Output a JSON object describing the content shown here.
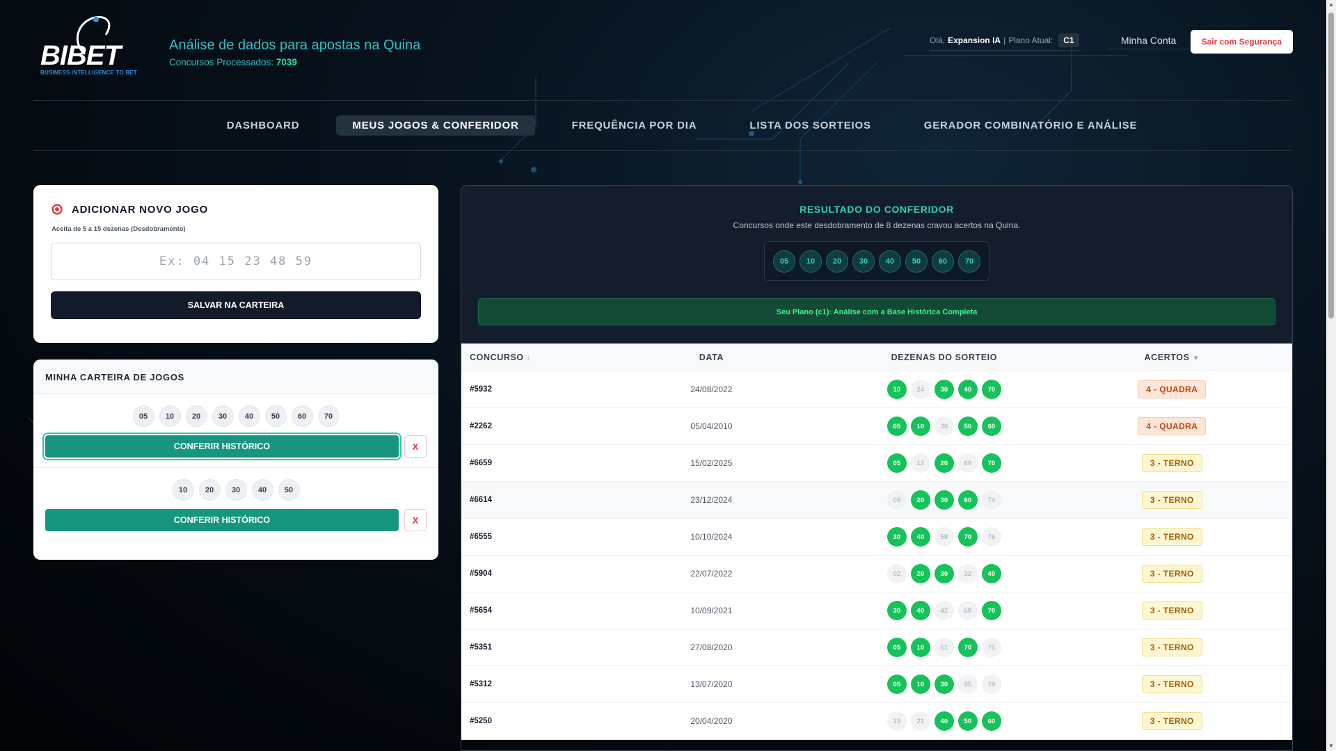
{
  "brand": {
    "logo_text": "BIBET",
    "logo_sub": "BUSINESS INTELLIGENCE TO BET",
    "tagline": "Análise de dados para apostas na Quina",
    "processed_label": "Concursos Processados:",
    "processed_value": "7039"
  },
  "user": {
    "greeting": "Olá,",
    "name": "Expansion IA",
    "separator": "|",
    "plan_label": "Plano Atual:",
    "plan": "C1",
    "account_link": "Minha Conta",
    "logout": "Sair com Segurança"
  },
  "nav": {
    "items": [
      {
        "label": "DASHBOARD"
      },
      {
        "label": "MEUS JOGOS & CONFERIDOR"
      },
      {
        "label": "FREQUÊNCIA POR DIA"
      },
      {
        "label": "LISTA DOS SORTEIOS"
      },
      {
        "label": "GERADOR COMBINATÓRIO E ANÁLISE"
      }
    ],
    "active_index": 1
  },
  "add_game": {
    "title": "ADICIONAR NOVO JOGO",
    "hint": "Aceita de 5 a 15 dezenas (Desdobramento)",
    "input_value": "",
    "input_placeholder": "Ex: 04 15 23 48 59",
    "save_label": "SALVAR NA CARTEIRA"
  },
  "wallet": {
    "title": "MINHA CARTEIRA DE JOGOS",
    "games": [
      {
        "numbers": [
          "05",
          "10",
          "20",
          "30",
          "40",
          "50",
          "60",
          "70"
        ],
        "check_label": "CONFERIR HISTÓRICO",
        "delete_label": "X"
      },
      {
        "numbers": [
          "10",
          "20",
          "30",
          "40",
          "50"
        ],
        "check_label": "CONFERIR HISTÓRICO",
        "delete_label": "X"
      }
    ]
  },
  "result": {
    "title": "RESULTADO DO CONFERIDOR",
    "subtitle": "Concursos onde este desdobramento de 8 dezenas cravou acertos na Quina.",
    "numbers": [
      "05",
      "10",
      "20",
      "30",
      "40",
      "50",
      "60",
      "70"
    ],
    "plan_banner": "Seu Plano (c1): Análise com a Base Histórica Completa",
    "columns": {
      "concurso": "CONCURSO",
      "data": "DATA",
      "dezenas": "DEZENAS DO SORTEIO",
      "acertos": "ACERTOS"
    },
    "sort_indicator": "↕",
    "sort_active": "▼",
    "rows": [
      {
        "concurso": "#5932",
        "data": "24/08/2022",
        "dezenas": [
          "10",
          "24",
          "30",
          "40",
          "70"
        ],
        "hits": [
          1,
          0,
          1,
          1,
          1
        ],
        "acertos": "4 - QUADRA",
        "level": "quadra"
      },
      {
        "concurso": "#2262",
        "data": "05/04/2010",
        "dezenas": [
          "05",
          "10",
          "36",
          "50",
          "60"
        ],
        "hits": [
          1,
          1,
          0,
          1,
          1
        ],
        "acertos": "4 - QUADRA",
        "level": "quadra"
      },
      {
        "concurso": "#6659",
        "data": "15/02/2025",
        "dezenas": [
          "05",
          "12",
          "20",
          "69",
          "70"
        ],
        "hits": [
          1,
          0,
          1,
          0,
          1
        ],
        "acertos": "3 - TERNO",
        "level": "terno"
      },
      {
        "concurso": "#6614",
        "data": "23/12/2024",
        "dezenas": [
          "09",
          "20",
          "30",
          "60",
          "74"
        ],
        "hits": [
          0,
          1,
          1,
          1,
          0
        ],
        "acertos": "3 - TERNO",
        "level": "terno"
      },
      {
        "concurso": "#6555",
        "data": "10/10/2024",
        "dezenas": [
          "30",
          "40",
          "58",
          "70",
          "76"
        ],
        "hits": [
          1,
          1,
          0,
          1,
          0
        ],
        "acertos": "3 - TERNO",
        "level": "terno"
      },
      {
        "concurso": "#5904",
        "data": "22/07/2022",
        "dezenas": [
          "02",
          "20",
          "30",
          "32",
          "40"
        ],
        "hits": [
          0,
          1,
          1,
          0,
          1
        ],
        "acertos": "3 - TERNO",
        "level": "terno"
      },
      {
        "concurso": "#5654",
        "data": "10/09/2021",
        "dezenas": [
          "30",
          "40",
          "42",
          "68",
          "70"
        ],
        "hits": [
          1,
          1,
          0,
          0,
          1
        ],
        "acertos": "3 - TERNO",
        "level": "terno"
      },
      {
        "concurso": "#5351",
        "data": "27/08/2020",
        "dezenas": [
          "05",
          "10",
          "51",
          "70",
          "75"
        ],
        "hits": [
          1,
          1,
          0,
          1,
          0
        ],
        "acertos": "3 - TERNO",
        "level": "terno"
      },
      {
        "concurso": "#5312",
        "data": "13/07/2020",
        "dezenas": [
          "05",
          "10",
          "30",
          "35",
          "79"
        ],
        "hits": [
          1,
          1,
          1,
          0,
          0
        ],
        "acertos": "3 - TERNO",
        "level": "terno"
      },
      {
        "concurso": "#5250",
        "data": "20/04/2020",
        "dezenas": [
          "13",
          "21",
          "40",
          "50",
          "60"
        ],
        "hits": [
          0,
          0,
          1,
          1,
          1
        ],
        "acertos": "3 - TERNO",
        "level": "terno"
      }
    ]
  }
}
